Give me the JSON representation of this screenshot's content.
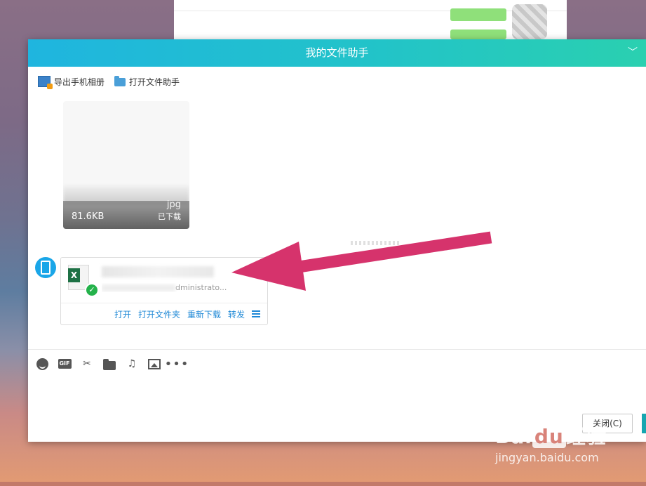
{
  "dialog": {
    "title": "我的文件助手",
    "toolbar": {
      "export_album": "导出手机相册",
      "open_file_helper": "打开文件助手"
    }
  },
  "image_message": {
    "size": "81.6KB",
    "ext": "jpg",
    "status": "已下载"
  },
  "file_message": {
    "icon": "excel-file-icon",
    "path_suffix": "dministrato...",
    "actions": {
      "open": "打开",
      "open_folder": "打开文件夹",
      "redownload": "重新下载",
      "forward": "转发"
    }
  },
  "composer": {
    "tools": [
      "emoji-icon",
      "gif-icon",
      "scissors-icon",
      "folder-icon",
      "music-icon",
      "image-icon",
      "more-icon"
    ]
  },
  "footer": {
    "close_label": "关闭(C)"
  },
  "watermark": {
    "brand_prefix": "Bai",
    "brand_du": "du",
    "brand_suffix": "经验",
    "url": "jingyan.baidu.com"
  },
  "colors": {
    "title_gradient_start": "#1fb5df",
    "title_gradient_end": "#2ad0b0",
    "link": "#1e88d6",
    "arrow": "#d6336c"
  }
}
